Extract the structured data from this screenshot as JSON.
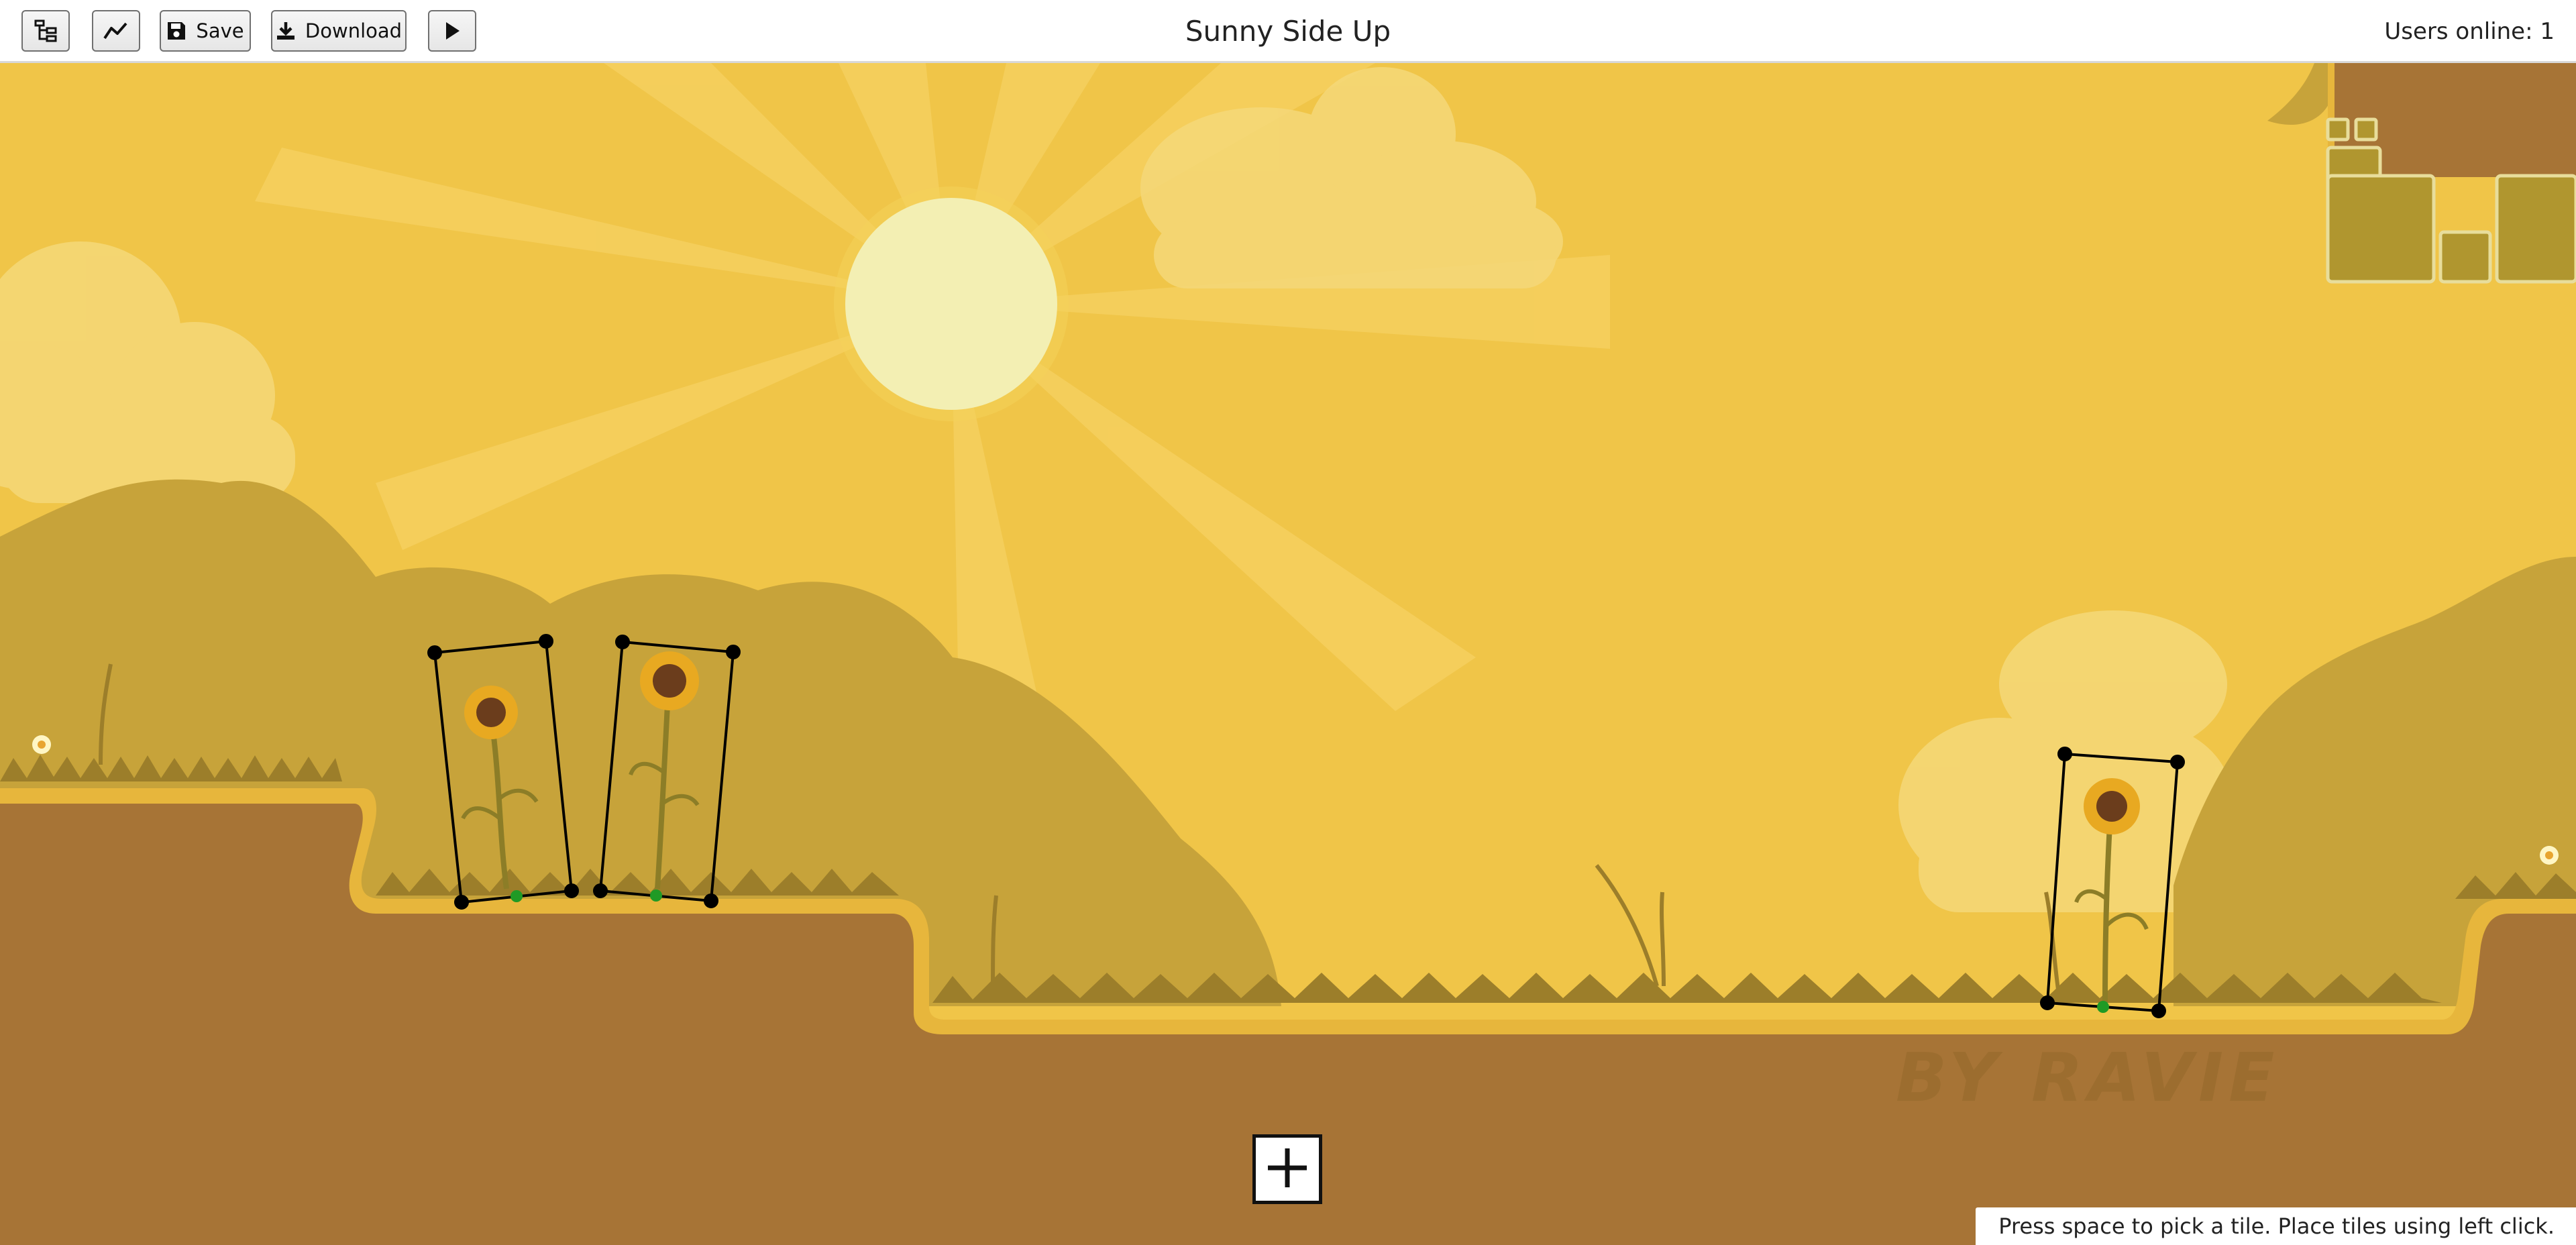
{
  "toolbar": {
    "save_label": "Save",
    "download_label": "Download",
    "title": "Sunny Side Up",
    "users_online": "Users online: 1"
  },
  "scene": {
    "credit_text": "BY RAVIE",
    "hint_text": "Press space to pick a tile. Place tiles using left click.",
    "colors": {
      "sky": "#f0c548",
      "sun": "#f3efb3",
      "hill": "#c7a33a",
      "dirt": "#a77436",
      "grass_rim": "#e7b63c",
      "selection": "#000000",
      "anchor": "#1f9a25"
    }
  },
  "icons": {
    "tree": "hierarchy-icon",
    "chart": "line-chart-icon",
    "save": "floppy-disk-icon",
    "download": "download-icon",
    "play": "play-icon",
    "add": "plus-icon"
  }
}
